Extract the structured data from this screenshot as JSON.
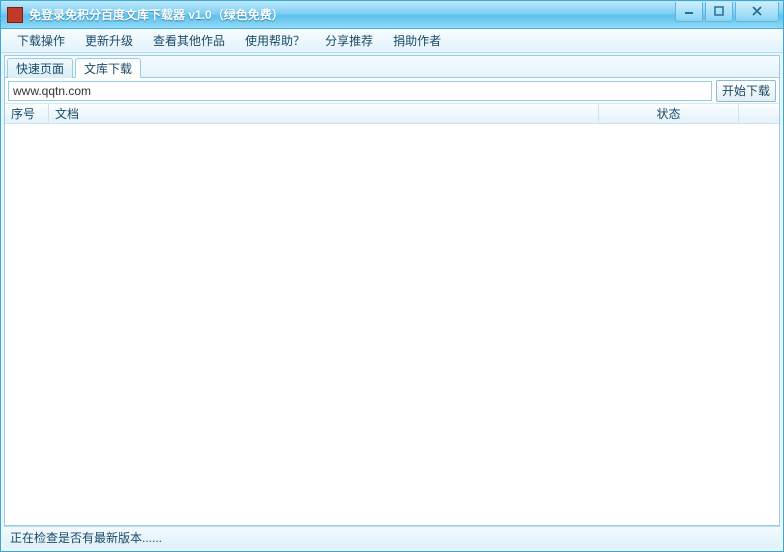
{
  "title": "免登录免积分百度文库下载器 v1.0（绿色免费）",
  "menu": {
    "download_ops": "下载操作",
    "update": "更新升级",
    "other_works": "查看其他作品",
    "help": "使用帮助？",
    "share": "分享推荐",
    "donate": "捐助作者"
  },
  "tabs": {
    "quick_page": "快速页面",
    "lib_download": "文库下载"
  },
  "url_input": "www.qqtn.com",
  "start_download": "开始下载",
  "columns": {
    "seq": "序号",
    "doc": "文档",
    "state": "状态"
  },
  "status_text": "正在检查是否有最新版本......"
}
